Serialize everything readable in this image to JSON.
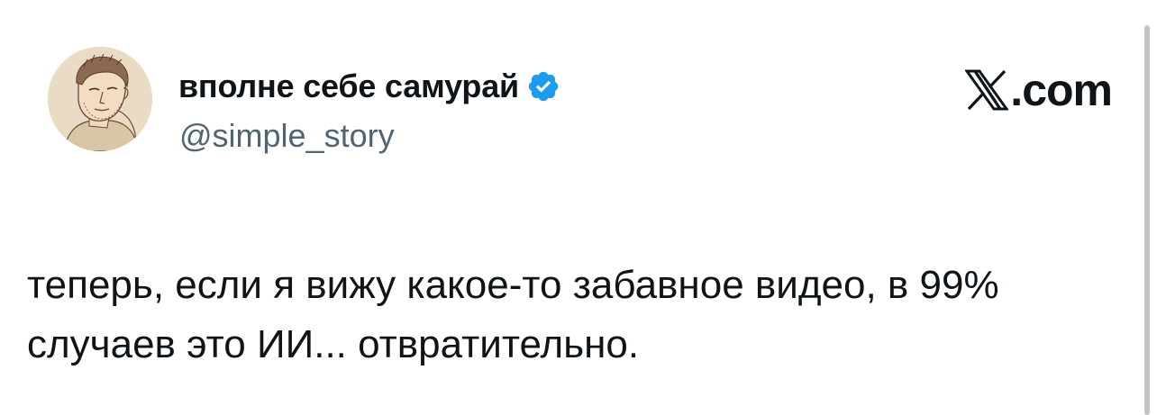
{
  "author": {
    "display_name": "вполне себе самурай",
    "handle": "@simple_story",
    "verified_icon": "verified-badge-icon",
    "avatar_icon": "avatar"
  },
  "brand": {
    "icon": "x-logo-icon",
    "suffix": ".com"
  },
  "tweet": {
    "text": "теперь, если я вижу какое-то забавное видео, в 99% случаев это ИИ... отвратительно."
  },
  "colors": {
    "text": "#0f1419",
    "secondary_text": "#536471",
    "verified": "#1d9bf0",
    "avatar_bg": "#eadbc4"
  }
}
